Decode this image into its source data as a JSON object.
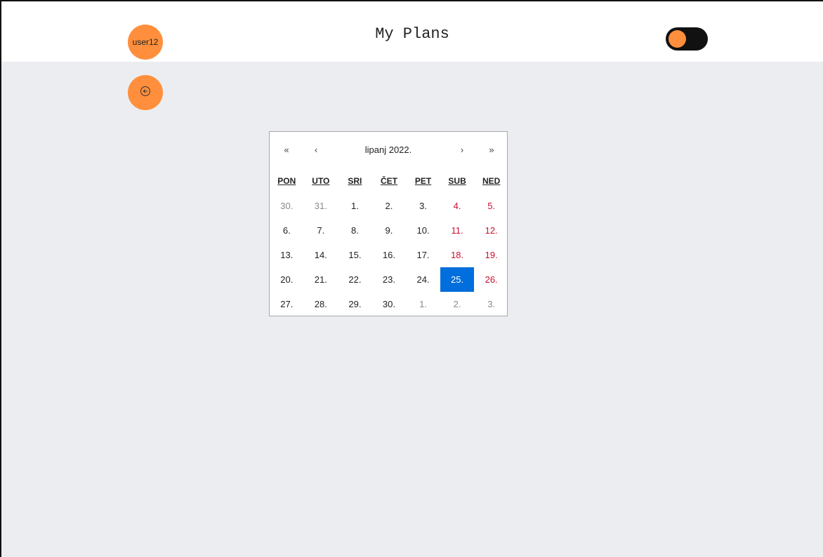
{
  "header": {
    "avatar_label": "user12",
    "title": "My Plans"
  },
  "colors": {
    "accent": "#ff8f3c",
    "selected": "#006edc",
    "weekend": "#c8102e",
    "background": "#ecedf1"
  },
  "calendar": {
    "nav": {
      "prev_year": "«",
      "prev_month": "‹",
      "label": "lipanj 2022.",
      "next_month": "›",
      "next_year": "»"
    },
    "weekdays": [
      "PON",
      "UTO",
      "SRI",
      "ČET",
      "PET",
      "SUB",
      "NED"
    ],
    "days": [
      {
        "label": "30.",
        "state": "other"
      },
      {
        "label": "31.",
        "state": "other"
      },
      {
        "label": "1.",
        "state": "normal"
      },
      {
        "label": "2.",
        "state": "normal"
      },
      {
        "label": "3.",
        "state": "normal"
      },
      {
        "label": "4.",
        "state": "weekend"
      },
      {
        "label": "5.",
        "state": "weekend"
      },
      {
        "label": "6.",
        "state": "normal"
      },
      {
        "label": "7.",
        "state": "normal"
      },
      {
        "label": "8.",
        "state": "normal"
      },
      {
        "label": "9.",
        "state": "normal"
      },
      {
        "label": "10.",
        "state": "normal"
      },
      {
        "label": "11.",
        "state": "weekend"
      },
      {
        "label": "12.",
        "state": "weekend"
      },
      {
        "label": "13.",
        "state": "normal"
      },
      {
        "label": "14.",
        "state": "normal"
      },
      {
        "label": "15.",
        "state": "normal"
      },
      {
        "label": "16.",
        "state": "normal"
      },
      {
        "label": "17.",
        "state": "normal"
      },
      {
        "label": "18.",
        "state": "weekend"
      },
      {
        "label": "19.",
        "state": "weekend"
      },
      {
        "label": "20.",
        "state": "normal"
      },
      {
        "label": "21.",
        "state": "normal"
      },
      {
        "label": "22.",
        "state": "normal"
      },
      {
        "label": "23.",
        "state": "normal"
      },
      {
        "label": "24.",
        "state": "normal"
      },
      {
        "label": "25.",
        "state": "selected"
      },
      {
        "label": "26.",
        "state": "weekend"
      },
      {
        "label": "27.",
        "state": "normal"
      },
      {
        "label": "28.",
        "state": "normal"
      },
      {
        "label": "29.",
        "state": "normal"
      },
      {
        "label": "30.",
        "state": "normal"
      },
      {
        "label": "1.",
        "state": "other"
      },
      {
        "label": "2.",
        "state": "other"
      },
      {
        "label": "3.",
        "state": "other"
      }
    ]
  },
  "icons": {
    "back": "arrow-left-circle-icon"
  }
}
